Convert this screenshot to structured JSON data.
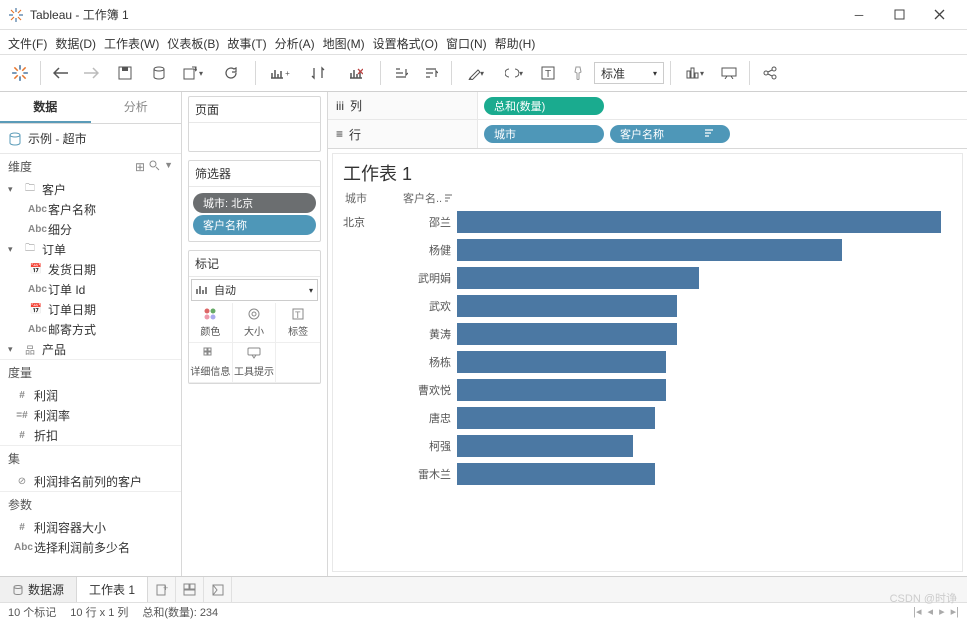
{
  "window": {
    "title": "Tableau - 工作簿 1"
  },
  "menu": [
    "文件(F)",
    "数据(D)",
    "工作表(W)",
    "仪表板(B)",
    "故事(T)",
    "分析(A)",
    "地图(M)",
    "设置格式(O)",
    "窗口(N)",
    "帮助(H)"
  ],
  "toolbar": {
    "view_mode": "标准"
  },
  "leftpane": {
    "tab_data": "数据",
    "tab_analysis": "分析",
    "datasource": "示例 - 超市",
    "dim_header": "维度",
    "dimensions": {
      "folder_customer": "客户",
      "customer_name": "客户名称",
      "subdivide": "细分",
      "folder_order": "订单",
      "ship_date": "发货日期",
      "order_id": "订单 Id",
      "order_date": "订单日期",
      "ship_mode": "邮寄方式",
      "folder_product": "产品"
    },
    "meas_header": "度量",
    "measures": {
      "profit": "利润",
      "profit_rate": "利润率",
      "discount": "折扣"
    },
    "sets_header": "集",
    "set1": "利润排名前列的客户",
    "params_header": "参数",
    "param1": "利润容器大小",
    "param2": "选择利润前多少名"
  },
  "midpane": {
    "pages_header": "页面",
    "filters_header": "筛选器",
    "filter_city": "城市: 北京",
    "filter_customer": "客户名称",
    "marks_header": "标记",
    "marks_type": "自动",
    "m_color": "颜色",
    "m_size": "大小",
    "m_label": "标签",
    "m_detail": "详细信息",
    "m_tooltip": "工具提示"
  },
  "shelves": {
    "col_label": "列",
    "col_pill": "总和(数量)",
    "row_label": "行",
    "row_pill1": "城市",
    "row_pill2": "客户名称"
  },
  "viz": {
    "title": "工作表 1",
    "head_city": "城市",
    "head_name": "客户名..",
    "city": "北京"
  },
  "chart_data": {
    "type": "bar",
    "title": "工作表 1",
    "xlabel": "总和(数量)",
    "ylabel": "客户名称",
    "city": "北京",
    "categories": [
      "邵兰",
      "杨健",
      "武明娟",
      "武欢",
      "黄涛",
      "杨栋",
      "曹欢悦",
      "唐忠",
      "柯强",
      "雷木兰"
    ],
    "values": [
      44,
      35,
      22,
      20,
      20,
      19,
      19,
      18,
      16,
      18
    ],
    "xlim": [
      0,
      45
    ]
  },
  "bottom": {
    "datasource": "数据源",
    "sheet1": "工作表 1"
  },
  "status": {
    "marks": "10 个标记",
    "rowcol": "10 行 x 1 列",
    "sum": "总和(数量): 234"
  },
  "watermark": "CSDN @时诤"
}
